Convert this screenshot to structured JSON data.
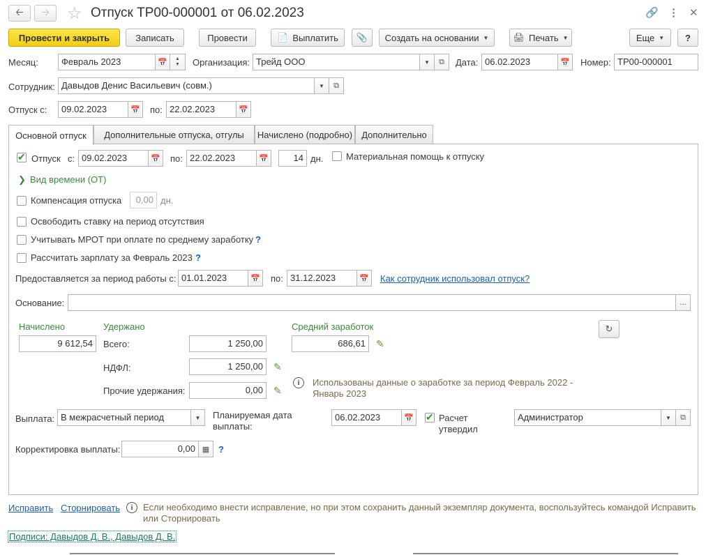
{
  "window": {
    "title": "Отпуск ТР00-000001 от 06.02.2023",
    "back_icon": "arrow-left-icon",
    "forward_icon": "arrow-right-icon",
    "favorite_icon": "star-icon"
  },
  "toolbar": {
    "post_close": "Провести и закрыть",
    "save": "Записать",
    "post": "Провести",
    "pay": "Выплатить",
    "create_based": "Создать на основании",
    "print": "Печать",
    "more": "Еще",
    "help": "?"
  },
  "header": {
    "month_label": "Месяц:",
    "month_value": "Февраль 2023",
    "org_label": "Организация:",
    "org_value": "Трейд ООО",
    "date_label": "Дата:",
    "date_value": "06.02.2023",
    "number_label": "Номер:",
    "number_value": "ТР00-000001",
    "employee_label": "Сотрудник:",
    "employee_value": "Давыдов Денис Васильевич (совм.)",
    "vac_from_label": "Отпуск с:",
    "vac_from_value": "09.02.2023",
    "vac_to_label": "по:",
    "vac_to_value": "22.02.2023"
  },
  "tabs": [
    {
      "label": "Основной отпуск",
      "active": true
    },
    {
      "label": "Дополнительные отпуска, отгулы",
      "active": false
    },
    {
      "label": "Начислено (подробно)",
      "active": false
    },
    {
      "label": "Дополнительно",
      "active": false
    }
  ],
  "main": {
    "vacation_label": "Отпуск",
    "vacation_checked": true,
    "from_label": "с:",
    "from_value": "09.02.2023",
    "to_label": "по:",
    "to_value": "22.02.2023",
    "days_value": "14",
    "days_unit": "дн.",
    "material_help_label": "Материальная помощь к отпуску",
    "material_help_checked": false,
    "time_kind": "Вид времени (ОТ)",
    "compensation_label": "Компенсация отпуска",
    "compensation_value": "0,00",
    "compensation_unit": "дн.",
    "free_rate_label": "Освободить ставку на период отсутствия",
    "mrot_label": "Учитывать МРОТ при оплате по среднему заработку",
    "mrot_help": "?",
    "calc_salary_label": "Рассчитать зарплату за Февраль 2023",
    "calc_salary_help": "?",
    "work_period_label": "Предоставляется за период работы с:",
    "work_period_from": "01.01.2023",
    "work_period_to_label": "по:",
    "work_period_to": "31.12.2023",
    "usage_link": "Как сотрудник использовал отпуск?",
    "basis_label": "Основание:",
    "basis_value": "",
    "basis_btn": "...",
    "accrued_header": "Начислено",
    "accrued_value": "9 612,54",
    "withheld_header": "Удержано",
    "total_label": "Всего:",
    "total_value": "1 250,00",
    "ndfl_label": "НДФЛ:",
    "ndfl_value": "1 250,00",
    "other_label": "Прочие удержания:",
    "other_value": "0,00",
    "avg_header": "Средний заработок",
    "avg_value": "686,61",
    "avg_note": "Использованы данные о заработке за период Февраль 2022 - Январь 2023",
    "payment_label": "Выплата:",
    "payment_value": "В межрасчетный период",
    "planned_date_label": "Планируемая дата выплаты:",
    "planned_date_value": "06.02.2023",
    "approved_label": "Расчет утвердил",
    "approved_checked": true,
    "approver_value": "Администратор",
    "correction_label": "Корректировка выплаты:",
    "correction_value": "0,00",
    "correction_help": "?"
  },
  "footer": {
    "fix_link": "Исправить",
    "reverse_link": "Сторнировать",
    "note": "Если необходимо внести исправление, но при этом сохранить данный экземпляр документа, воспользуйтесь командой Исправить или Сторнировать",
    "signatures": "Подписи: Давыдов Д. В., Давыдов Д. В."
  },
  "colors": {
    "primary_button": "#f2cf10",
    "link": "#1c5fa8",
    "section_green": "#3a8a3a",
    "checkmark": "#2c9a2c"
  }
}
